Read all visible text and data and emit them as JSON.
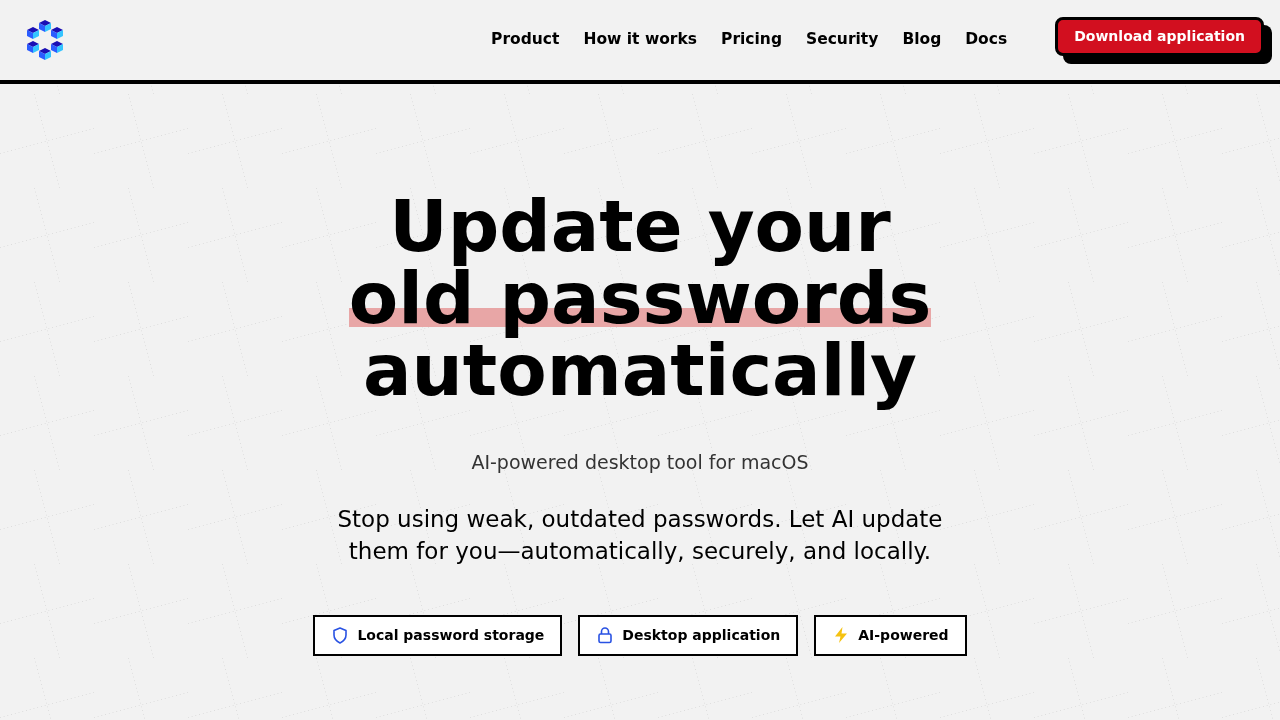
{
  "nav": {
    "items": [
      "Product",
      "How it works",
      "Pricing",
      "Security",
      "Blog",
      "Docs"
    ],
    "cta": "Download application"
  },
  "hero": {
    "headline": [
      {
        "text": "Update your",
        "highlighted": false
      },
      {
        "text": "old passwords",
        "highlighted": true
      },
      {
        "text": "automatically",
        "highlighted": false
      }
    ],
    "subtitle": "AI-powered desktop tool for macOS",
    "description": "Stop using weak, outdated passwords. Let AI update them for you—automatically, securely, and locally.",
    "features": [
      {
        "kind": "shield",
        "label": "Local password storage"
      },
      {
        "kind": "lock",
        "label": "Desktop application"
      },
      {
        "kind": "bolt",
        "label": "AI-powered"
      }
    ]
  }
}
